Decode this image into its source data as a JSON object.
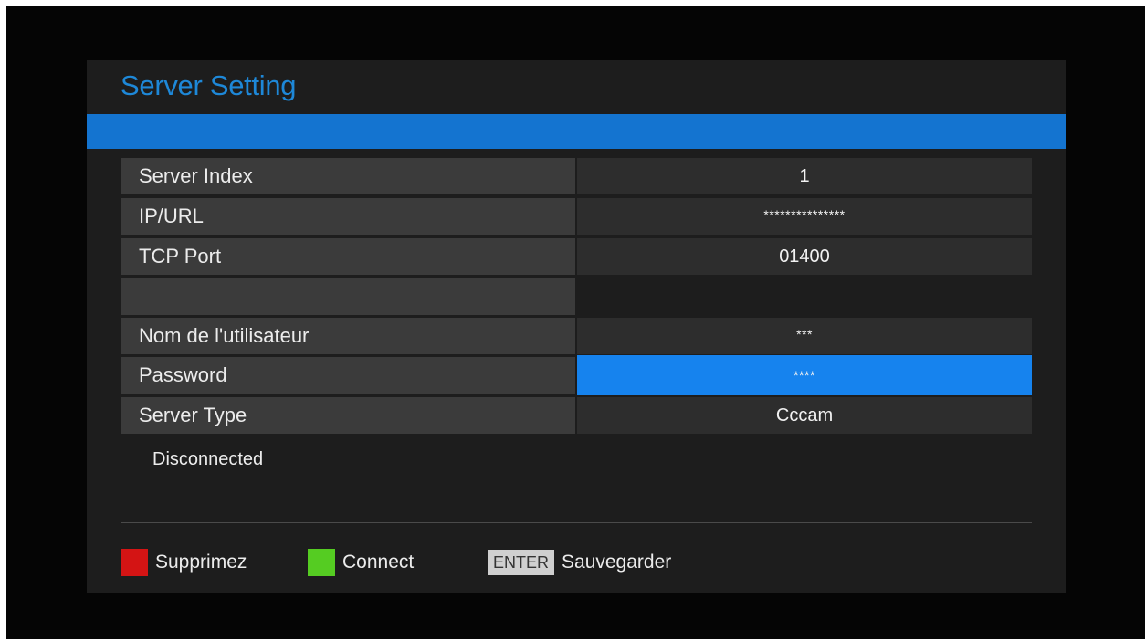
{
  "title": "Server Setting",
  "rows": [
    {
      "label": "Server Index",
      "value": "1"
    },
    {
      "label": "IP/URL",
      "value": "***************"
    },
    {
      "label": "TCP Port",
      "value": "01400"
    },
    {
      "label": "",
      "value": ""
    },
    {
      "label": "Nom de l'utilisateur",
      "value": "***"
    },
    {
      "label": "Password",
      "value": "****"
    },
    {
      "label": "Server Type",
      "value": "Cccam"
    }
  ],
  "status": "Disconnected",
  "legend": {
    "red_label": "Supprimez",
    "green_label": "Connect",
    "enter_key": "ENTER",
    "enter_label": "Sauvegarder"
  },
  "colors": {
    "title": "#1e88d8",
    "header_bar": "#1474d0",
    "selected": "#1683ee",
    "red_key": "#d41414",
    "green_key": "#55cc22"
  }
}
